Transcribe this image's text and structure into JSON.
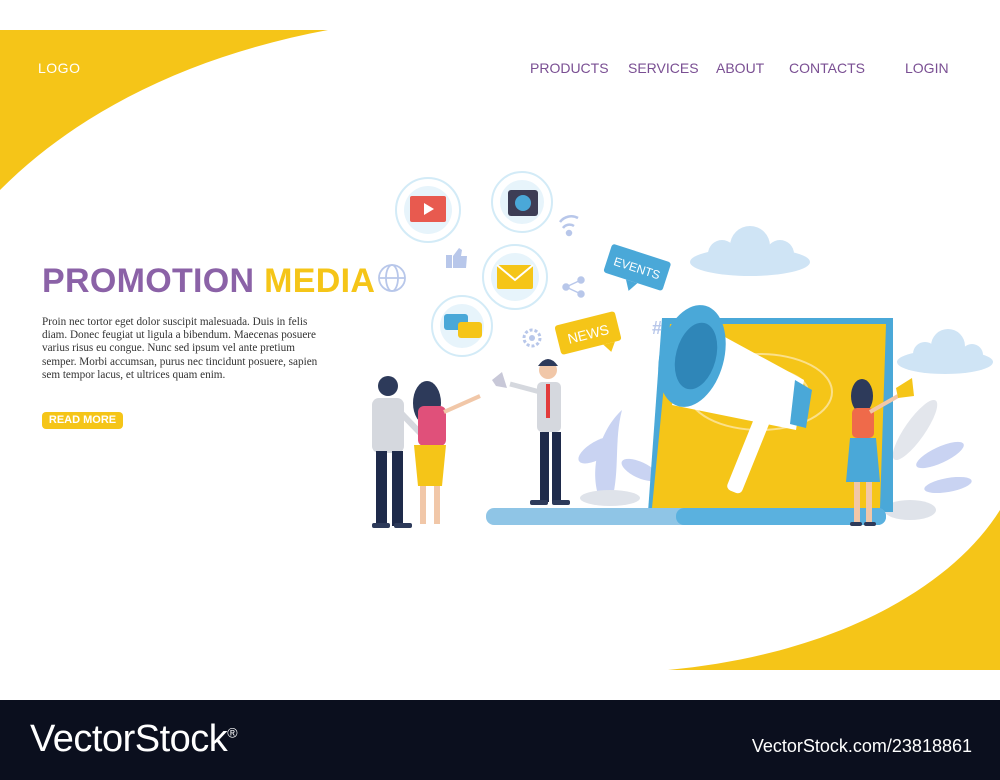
{
  "header": {
    "logo": "LOGO",
    "nav": [
      "PRODUCTS",
      "SERVICES",
      "ABOUT",
      "CONTACTS",
      "LOGIN"
    ]
  },
  "hero": {
    "title_part1": "PROMOTION",
    "title_part2": "MEDIA",
    "body": "Proin nec tortor eget dolor suscipit malesuada. Duis in felis diam. Donec feugiat ut ligula a bibendum. Maecenas posuere varius risus eu congue. Nunc sed ipsum vel ante pretium semper. Morbi accumsan, purus nec tincidunt posuere, sapien sem tempor lacus, et ultrices quam enim.",
    "read_more": "READ MORE"
  },
  "illustration": {
    "bubble_events": "EVENTS",
    "bubble_news": "NEWS",
    "hashtag": "#"
  },
  "watermark": {
    "brand": "VectorStock",
    "registered": "®",
    "id": "VectorStock.com/23818861"
  },
  "colors": {
    "accent_yellow": "#f5c518",
    "accent_purple": "#8b62a7",
    "nav_purple": "#7a4f93",
    "megaphone_blue": "#4aa8d8",
    "footer_bg": "#0b0f1e"
  }
}
